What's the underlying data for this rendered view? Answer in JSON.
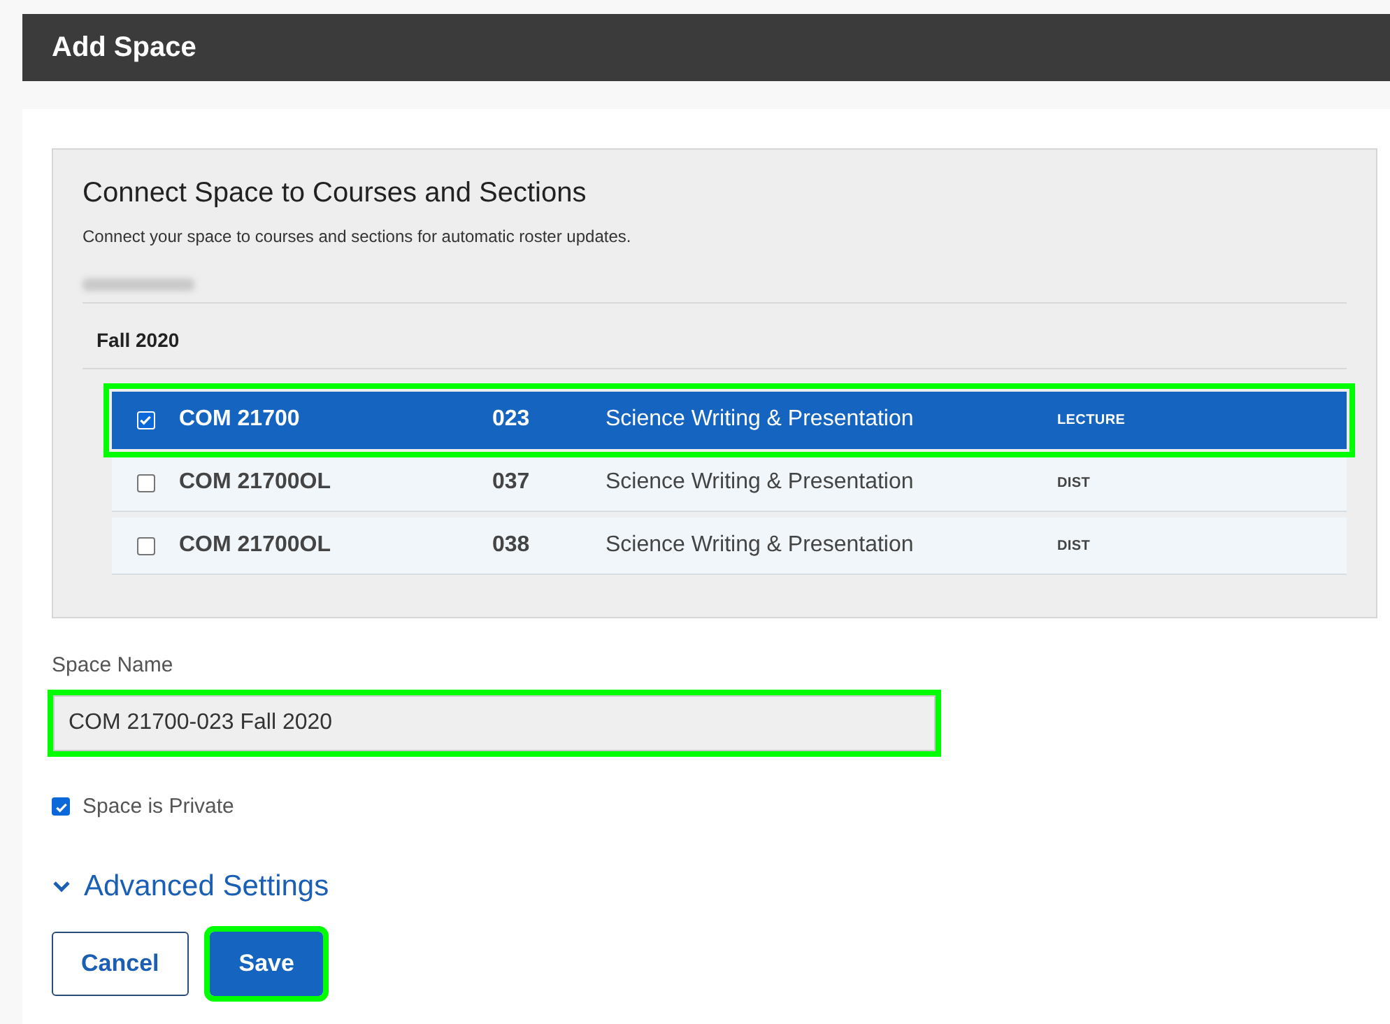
{
  "window": {
    "title": "Add Space"
  },
  "connect": {
    "heading": "Connect Space to Courses and Sections",
    "description": "Connect your space to courses and sections for automatic roster updates.",
    "instructor_redacted": true,
    "term": "Fall 2020",
    "courses": [
      {
        "code": "COM 21700",
        "section": "023",
        "title": "Science Writing & Presentation",
        "type": "LECTURE",
        "selected": true,
        "highlighted": true
      },
      {
        "code": "COM 21700OL",
        "section": "037",
        "title": "Science Writing & Presentation",
        "type": "DIST",
        "selected": false,
        "highlighted": false
      },
      {
        "code": "COM 21700OL",
        "section": "038",
        "title": "Science Writing & Presentation",
        "type": "DIST",
        "selected": false,
        "highlighted": false
      }
    ]
  },
  "space_name": {
    "label": "Space Name",
    "value": "COM 21700-023 Fall 2020",
    "highlighted": true
  },
  "private": {
    "label": "Space is Private",
    "checked": true
  },
  "advanced": {
    "label": "Advanced Settings",
    "expanded": false
  },
  "buttons": [
    {
      "kind": "secondary",
      "label": "Cancel",
      "highlighted": false
    },
    {
      "kind": "primary",
      "label": "Save",
      "highlighted": true
    }
  ]
}
